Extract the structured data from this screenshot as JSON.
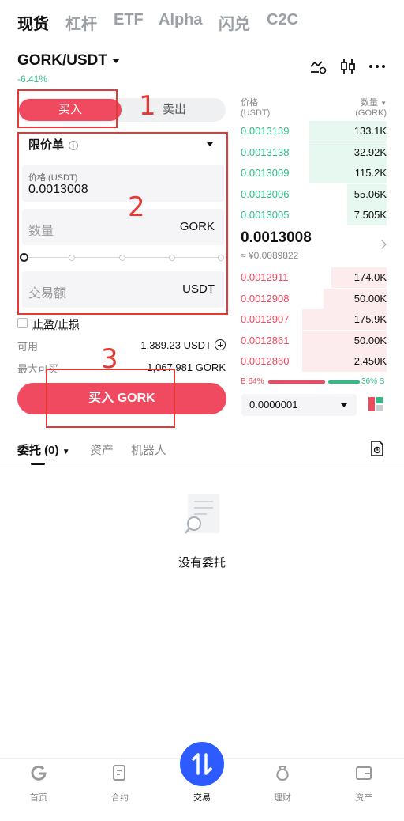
{
  "top_tabs": [
    "现货",
    "杠杆",
    "ETF",
    "Alpha",
    "闪兑",
    "C2C"
  ],
  "pair": {
    "symbol": "GORK/USDT",
    "change": "-6.41%"
  },
  "toggle": {
    "buy": "买入",
    "sell": "卖出"
  },
  "order_form": {
    "order_type": "限价单",
    "price_label": "价格 (USDT)",
    "price_value": "0.0013008",
    "quantity_placeholder": "数量",
    "quantity_unit": "GORK",
    "amount_placeholder": "交易额",
    "amount_unit": "USDT",
    "tpsl_label": "止盈/止损",
    "available_label": "可用",
    "available_value": "1,389.23 USDT",
    "max_buy_label": "最大可买",
    "max_buy_value": "1,067.981 GORK",
    "submit_label": "买入 GORK"
  },
  "annotations": [
    "1",
    "2",
    "3"
  ],
  "order_book": {
    "price_header": [
      "价格",
      "(USDT)"
    ],
    "qty_header": [
      "数量",
      "(GORK)"
    ],
    "asks": [
      {
        "price": "0.0013139",
        "qty": "133.1K",
        "depth": 0.53
      },
      {
        "price": "0.0013138",
        "qty": "32.92K",
        "depth": 0.53
      },
      {
        "price": "0.0013009",
        "qty": "115.2K",
        "depth": 0.53
      },
      {
        "price": "0.0013006",
        "qty": "55.06K",
        "depth": 0.27
      },
      {
        "price": "0.0013005",
        "qty": "7.505K",
        "depth": 0.27
      }
    ],
    "last_price": "0.0013008",
    "last_price_fiat": "≈ ¥0.0089822",
    "bids": [
      {
        "price": "0.0012911",
        "qty": "174.0K",
        "depth": 0.38
      },
      {
        "price": "0.0012908",
        "qty": "50.00K",
        "depth": 0.43
      },
      {
        "price": "0.0012907",
        "qty": "175.9K",
        "depth": 0.58
      },
      {
        "price": "0.0012861",
        "qty": "50.00K",
        "depth": 0.58
      },
      {
        "price": "0.0012860",
        "qty": "2.450K",
        "depth": 0.58
      }
    ],
    "buy_ratio": "B 64%",
    "sell_ratio": "36% S",
    "depth_step": "0.0000001"
  },
  "orders_tabs": {
    "orders": "委托 (0)",
    "assets": "资产",
    "bots": "机器人"
  },
  "empty_state": "没有委托",
  "bottom_nav": [
    "首页",
    "合约",
    "交易",
    "理财",
    "资产"
  ],
  "colors": {
    "buy": "#ef4a5f",
    "sell": "#2ebd85",
    "accent": "#2e5bff"
  }
}
